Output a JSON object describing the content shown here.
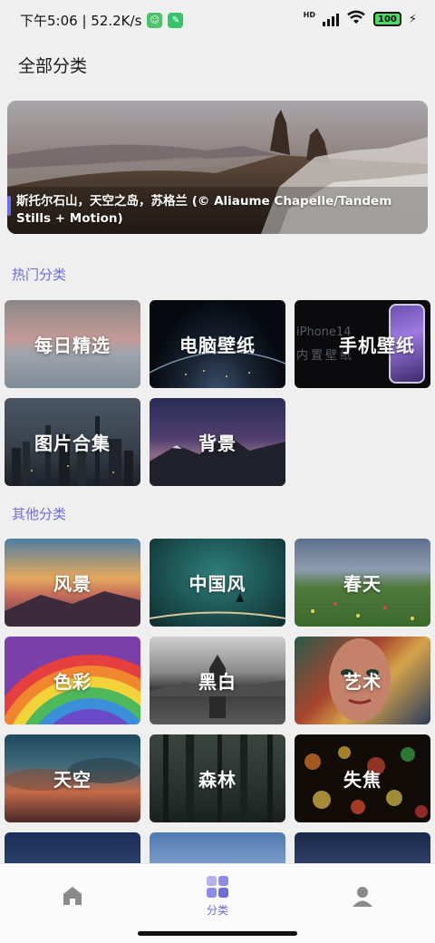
{
  "status_bar": {
    "time_speed": "下午5:06 | 52.2K/s",
    "network": "HD",
    "battery": "100"
  },
  "header": {
    "title": "全部分类"
  },
  "banner": {
    "caption": "斯托尔石山，天空之岛，苏格兰 (© Aliaume Chapelle/Tandem Stills + Motion)"
  },
  "sections": {
    "hot": {
      "title": "热门分类",
      "items": [
        "每日精选",
        "电脑壁纸",
        "手机壁纸",
        "图片合集",
        "背景"
      ]
    },
    "other": {
      "title": "其他分类",
      "items": [
        "风景",
        "中国风",
        "春天",
        "色彩",
        "黑白",
        "艺术",
        "天空",
        "森林",
        "失焦"
      ]
    }
  },
  "phone_card_overlay": {
    "line1": "iPhone14",
    "line2": "内置壁纸"
  },
  "bottom_nav": {
    "items": [
      {
        "icon": "home-icon",
        "label": ""
      },
      {
        "icon": "category-icon",
        "label": "分类"
      },
      {
        "icon": "profile-icon",
        "label": ""
      }
    ],
    "active_color": "#6d6cd8"
  },
  "colors": {
    "accent": "#6d6cd8",
    "background": "#efefef"
  }
}
